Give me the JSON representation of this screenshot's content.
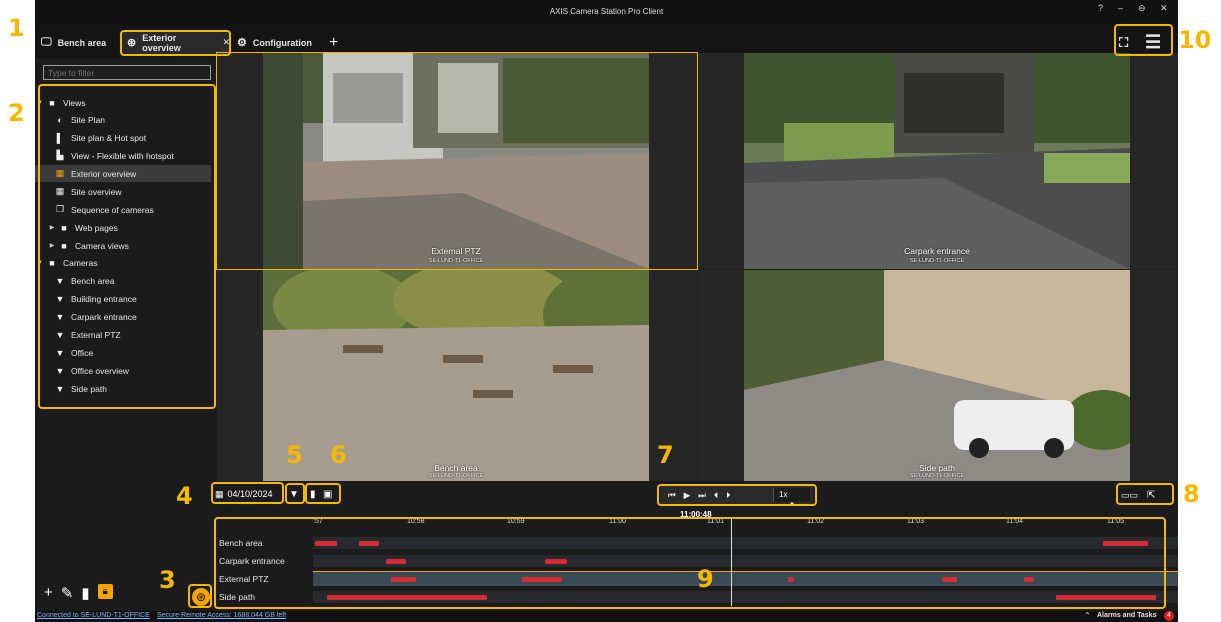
{
  "window": {
    "title": "AXIS Camera Station Pro Client",
    "help": "?",
    "minimize": "–",
    "restore": "⊖",
    "close": "✕"
  },
  "tabs": [
    {
      "label": "Bench area"
    },
    {
      "label": "Exterior overview",
      "close": "✕"
    },
    {
      "label": "Configuration"
    }
  ],
  "tab_add": "+",
  "sidebar": {
    "filter_placeholder": "Type to filter",
    "tree": {
      "views_label": "Views",
      "views": [
        "Site Plan",
        "Site plan & Hot spot",
        "View - Flexible with hotspot",
        "Exterior overview",
        "Site overview",
        "Sequence of cameras",
        "Web pages",
        "Camera views"
      ],
      "cameras_label": "Cameras",
      "cameras": [
        "Bench area",
        "Building entrance",
        "Carpark entrance",
        "External PTZ",
        "Office",
        "Office overview",
        "Side path"
      ]
    }
  },
  "cameras_grid": [
    {
      "name": "External PTZ",
      "server": "SE-LUND-T1-OFFICE"
    },
    {
      "name": "Carpark entrance",
      "server": "SE-LUND-T1-OFFICE"
    },
    {
      "name": "Bench area",
      "server": "SE-LUND-T1-OFFICE"
    },
    {
      "name": "Side path",
      "server": "SE-LUND-T1-OFFICE"
    }
  ],
  "controls": {
    "date": "04/10/2024",
    "speed": "1x",
    "current_time": "11:00:48"
  },
  "timeline": {
    "ticks": [
      ":57",
      "10:58",
      "10:59",
      "11:00",
      "11:01",
      "11:02",
      "11:03",
      "11:04",
      "11:05"
    ],
    "rows": [
      "Bench area",
      "Carpark entrance",
      "External PTZ",
      "Side path"
    ]
  },
  "status": {
    "connection": "Connected to SE-LUND-T1-OFFICE",
    "remote": "Secure Remote Access: 1688.044 GB left",
    "alarms": "Alarms and Tasks",
    "alarms_count": "4"
  },
  "callouts": [
    "1",
    "2",
    "3",
    "4",
    "5",
    "6",
    "7",
    "8",
    "9",
    "10"
  ],
  "colors": {
    "accent": "#f5b800",
    "recording": "#d42b35",
    "background": "#1b1b1b"
  }
}
